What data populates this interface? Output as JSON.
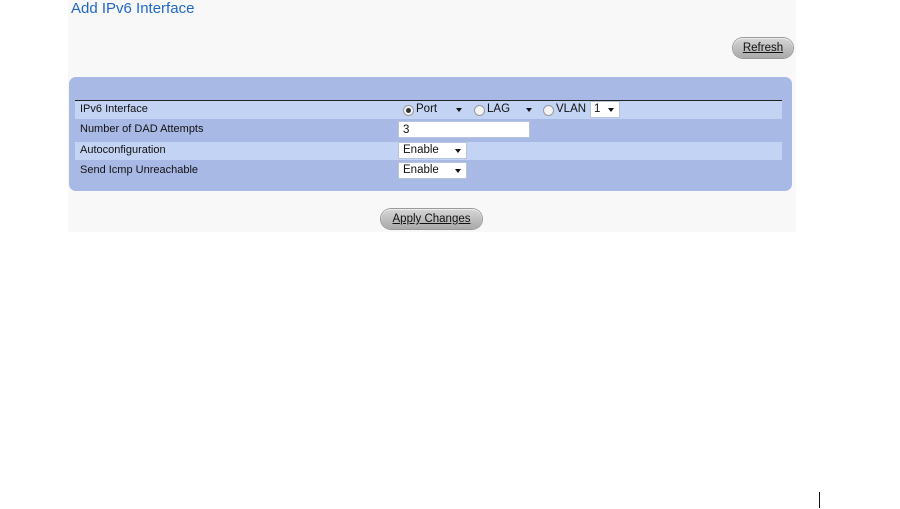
{
  "page": {
    "title": "Add IPv6 Interface",
    "refresh_label": "Refresh",
    "apply_label": "Apply Changes"
  },
  "form": {
    "rows": [
      {
        "label": "IPv6 Interface",
        "port_label": "Port",
        "port_value": "",
        "lag_label": "LAG",
        "lag_value": "",
        "vlan_label": "VLAN",
        "vlan_value": "1",
        "selected": "Port"
      },
      {
        "label": "Number of DAD Attempts",
        "value": "3"
      },
      {
        "label": "Autoconfiguration",
        "value": "Enable"
      },
      {
        "label": "Send Icmp Unreachable",
        "value": "Enable"
      }
    ]
  },
  "icons": {
    "dropdown": "chevron-down-icon",
    "radio": "radio-icon"
  },
  "colors": {
    "title": "#1f68c8",
    "form_background": "#a9b9e5",
    "row_highlight": "#c3d3f3",
    "panel_background": "#f8f8f8"
  }
}
